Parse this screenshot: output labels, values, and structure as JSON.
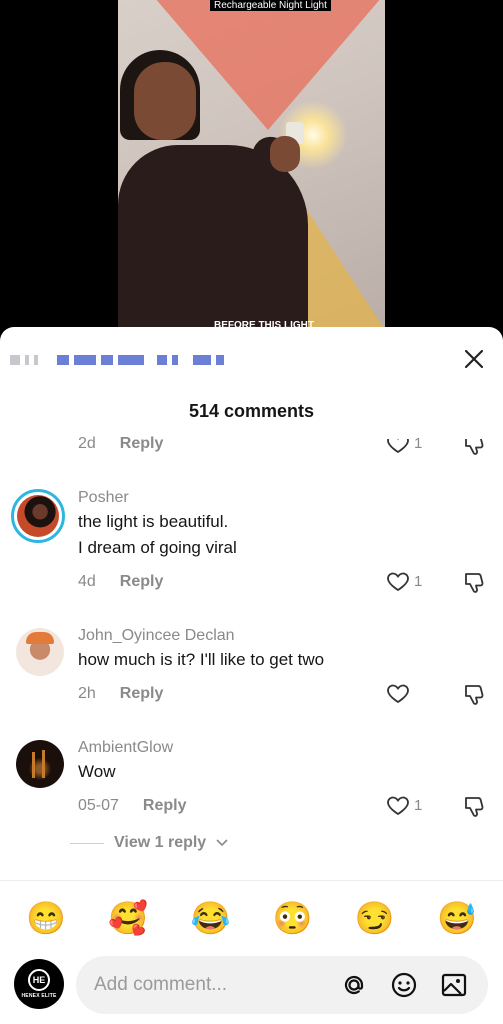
{
  "video": {
    "caption": "Rechargeable Night Light",
    "overlay_text": "BEFORE THIS LIGHT"
  },
  "sheet": {
    "comment_count": "514 comments",
    "partial_row": {
      "time": "2d",
      "reply": "Reply",
      "likes": "1"
    },
    "comments": [
      {
        "username": "Posher",
        "lines": [
          "the light is beautiful.",
          "I dream of going viral"
        ],
        "time": "4d",
        "reply": "Reply",
        "likes": "1"
      },
      {
        "username": "John_Oyincee Declan",
        "lines": [
          "how much is it? I'll like to get two"
        ],
        "time": "2h",
        "reply": "Reply",
        "likes": ""
      },
      {
        "username": "AmbientGlow",
        "lines": [
          "Wow"
        ],
        "time": "05-07",
        "reply": "Reply",
        "likes": "1"
      }
    ],
    "view_replies": "View 1 reply"
  },
  "emojis": [
    "😁",
    "🥰",
    "😂",
    "😳",
    "😏",
    "😅"
  ],
  "composer": {
    "placeholder": "Add comment...",
    "avatar_logo": "HE",
    "avatar_brand": "HENEX ELITE"
  },
  "icons": [
    "close-icon",
    "heart-icon",
    "dislike-icon",
    "chevron-down-icon",
    "at-icon",
    "emoji-icon",
    "image-icon"
  ]
}
